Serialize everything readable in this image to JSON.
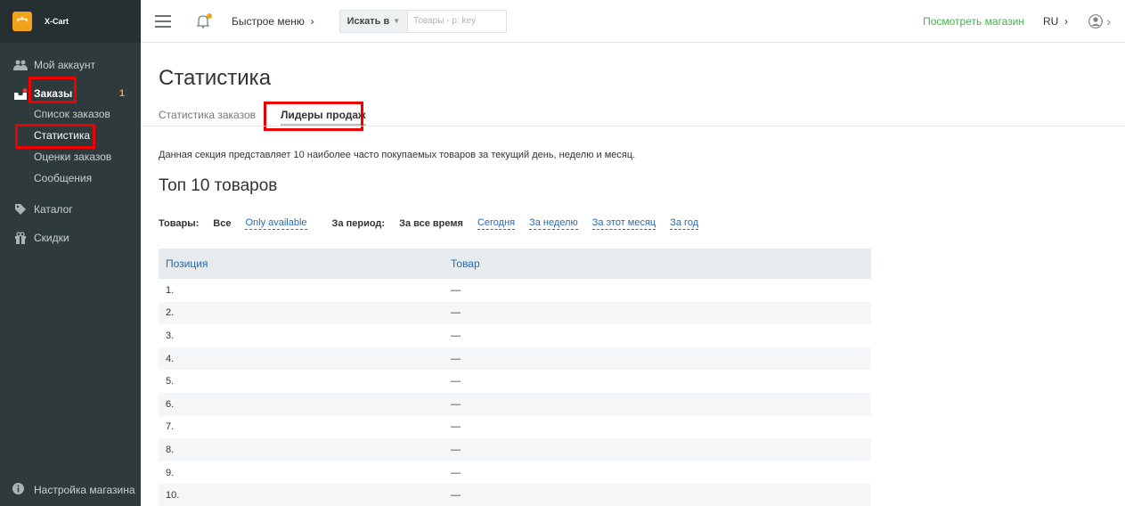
{
  "app": {
    "logo_text": "X-Cart",
    "logo_glyph": "宀"
  },
  "sidebar": {
    "items": [
      {
        "label": "Мой аккаунт",
        "icon": "users-icon"
      },
      {
        "label": "Заказы",
        "icon": "inbox-icon",
        "badge": "1"
      },
      {
        "label": "Каталог",
        "icon": "tag-icon"
      },
      {
        "label": "Скидки",
        "icon": "gift-icon"
      }
    ],
    "orders_sub": [
      {
        "label": "Список заказов"
      },
      {
        "label": "Статистика"
      },
      {
        "label": "Оценки заказов"
      },
      {
        "label": "Сообщения"
      }
    ],
    "store_settings": "Настройка магазина"
  },
  "topbar": {
    "quick_menu": "Быстрое меню",
    "search_button": "Искать в",
    "search_placeholder": "Товары - p: key",
    "view_store": "Посмотреть магазин",
    "lang": "RU"
  },
  "main": {
    "title": "Статистика",
    "tabs": [
      {
        "label": "Статистика заказов"
      },
      {
        "label": "Лидеры продаж"
      }
    ],
    "description": "Данная секция представляет 10 наиболее часто покупаемых товаров за текущий день, неделю и месяц.",
    "subtitle": "Топ 10 товаров",
    "filters": {
      "products_label": "Товары:",
      "products_options": [
        "Все",
        "Only available"
      ],
      "period_label": "За период:",
      "period_options": [
        "За все время",
        "Сегодня",
        "За неделю",
        "За этот месяц",
        "За год"
      ]
    },
    "table": {
      "headers": [
        "Позиция",
        "Товар"
      ],
      "rows": [
        [
          "1.",
          "—"
        ],
        [
          "2.",
          "—"
        ],
        [
          "3.",
          "—"
        ],
        [
          "4.",
          "—"
        ],
        [
          "5.",
          "—"
        ],
        [
          "6.",
          "—"
        ],
        [
          "7.",
          "—"
        ],
        [
          "8.",
          "—"
        ],
        [
          "9.",
          "—"
        ],
        [
          "10.",
          "—"
        ]
      ]
    }
  },
  "colors": {
    "sidebar_bg": "#2f3a3d",
    "accent": "#f2a31b",
    "link": "#2a6ab0",
    "store_link": "#4caf50",
    "highlight": "#e00000"
  }
}
